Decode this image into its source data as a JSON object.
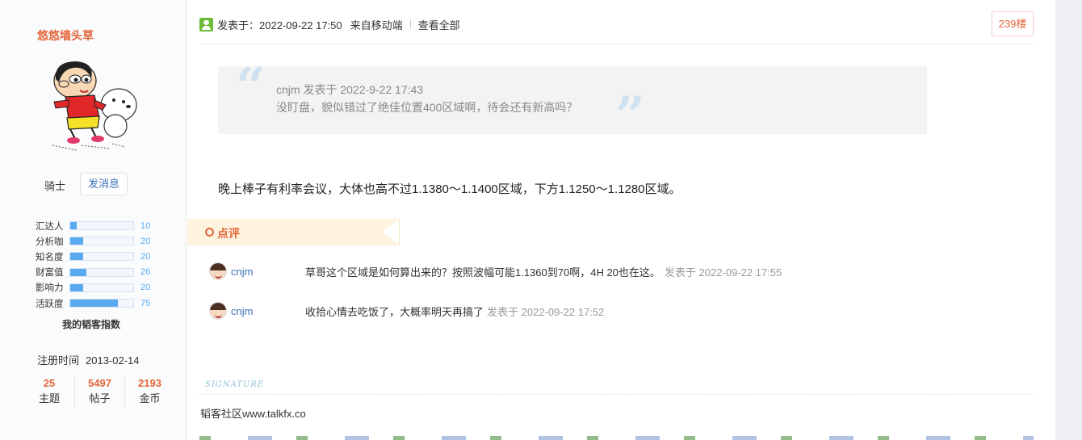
{
  "user": {
    "name": "悠悠墙头草",
    "rank": "骑士",
    "message_button": "发消息",
    "stats_title": "我的韬客指数",
    "stats": [
      {
        "label": "汇达人",
        "value": "10",
        "fraction": 0.1
      },
      {
        "label": "分析咖",
        "value": "20",
        "fraction": 0.2
      },
      {
        "label": "知名度",
        "value": "20",
        "fraction": 0.2
      },
      {
        "label": "财富值",
        "value": "26",
        "fraction": 0.26
      },
      {
        "label": "影响力",
        "value": "20",
        "fraction": 0.2
      },
      {
        "label": "活跃度",
        "value": "75",
        "fraction": 0.75
      }
    ],
    "reg_label": "注册时间",
    "reg_date": "2013-02-14",
    "counts": [
      {
        "num": "25",
        "label": "主题"
      },
      {
        "num": "5497",
        "label": "帖子"
      },
      {
        "num": "2193",
        "label": "金币"
      }
    ]
  },
  "post": {
    "posted_at": "发表于：2022-09-22 17:50",
    "source": "来自移动端",
    "view_all": "查看全部",
    "floor": "239楼",
    "quote": {
      "meta": "cnjm 发表于 2022-9-22 17:43",
      "text": "没盯盘，貌似错过了绝佳位置400区域啊，待会还有新高吗？"
    },
    "body": "晚上棒子有利率会议，大体也高不过1.1380～1.1400区域，下方1.1250～1.1280区域。"
  },
  "review": {
    "title": "点评",
    "comments": [
      {
        "user": "cnjm",
        "text": "草哥这个区域是如何算出来的？按照波幅可能1.1360到70啊，4H 20也在这。",
        "time": "发表于 2022-09-22 17:55"
      },
      {
        "user": "cnjm",
        "text": "收拾心情去吃饭了，大概率明天再搞了",
        "time": "发表于 2022-09-22 17:52"
      }
    ]
  },
  "signature": {
    "label": "SIGNATURE",
    "text": "韬客社区www.talkfx.co"
  },
  "colors": {
    "accent": "#e4653a",
    "link": "#3b70b8",
    "bar": "#5aaaf0",
    "online": "#6dbb39"
  }
}
